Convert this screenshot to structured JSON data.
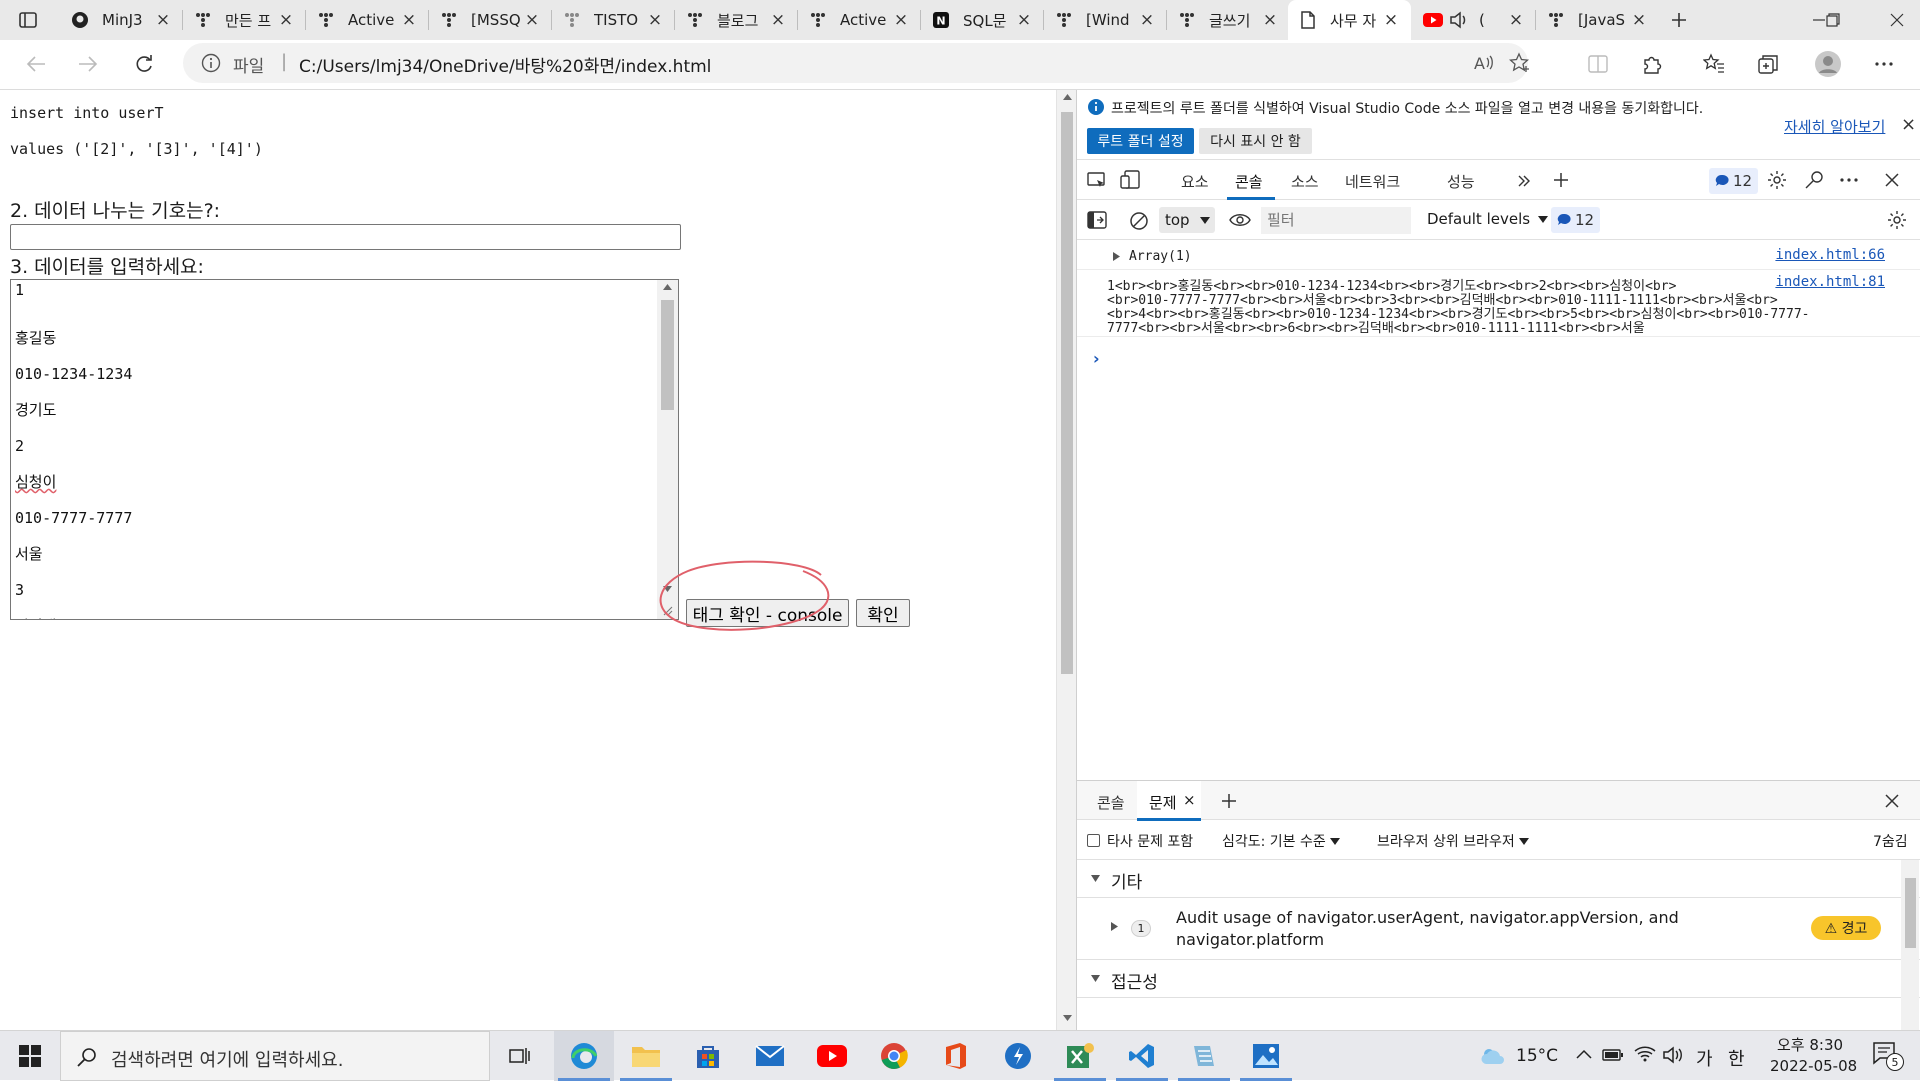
{
  "tabs": [
    {
      "label": "MinJ3",
      "icon": "github"
    },
    {
      "label": "만든 프",
      "icon": "tistory"
    },
    {
      "label": "Active",
      "icon": "tistory"
    },
    {
      "label": "[MSSQ",
      "icon": "tistory"
    },
    {
      "label": "TISTO",
      "icon": "tistory"
    },
    {
      "label": "블로그",
      "icon": "tistory"
    },
    {
      "label": "Active",
      "icon": "tistory"
    },
    {
      "label": "SQL문",
      "icon": "notion"
    },
    {
      "label": "[Wind",
      "icon": "tistory-bracket"
    },
    {
      "label": "글쓰기",
      "icon": "tistory"
    },
    {
      "label": "사무 자",
      "icon": "page",
      "active": true
    },
    {
      "label": "(",
      "icon": "youtube"
    },
    {
      "label": "[JavaS",
      "icon": "tistory"
    }
  ],
  "address": {
    "scheme_label": "파일",
    "separator": "|",
    "url": "C:/Users/lmj34/OneDrive/바탕%20화면/index.html"
  },
  "page": {
    "sql_line1": "insert into userT",
    "sql_line2": "values ('[2]', '[3]', '[4]')",
    "q2_label": "2. 데이터 나누는 기호는?:",
    "q2_value": "",
    "q3_label": "3. 데이터를 입력하세요:",
    "textarea_lines": [
      "1",
      "홍길동",
      "010-1234-1234",
      "경기도",
      "2",
      "심청이",
      "010-7777-7777",
      "서울",
      "3",
      "김덕배"
    ],
    "btn_tag_check": "태그 확인 - console",
    "btn_confirm": "확인"
  },
  "devtools": {
    "info_text": "프로젝트의 루트 폴더를 식별하여 Visual Studio Code 소스 파일을 열고 변경 내용을 동기화합니다.",
    "info_link": "자세히 알아보기",
    "btn_set_root": "루트 폴더 설정",
    "btn_dont_show": "다시 표시 안 함",
    "tabs": [
      "요소",
      "콘솔",
      "소스",
      "네트워크",
      "성능"
    ],
    "active_tab": "콘솔",
    "issue_count": "12",
    "context": "top",
    "filter_placeholder": "필터",
    "levels": "Default levels",
    "levels_count": "12",
    "console": [
      {
        "text": "Array(1)",
        "source": "index.html:66"
      },
      {
        "lines": [
          "1<br><br>홍길동<br><br>010-1234-1234<br><br>경기도<br><br>2<br><br>심청이<br>",
          "<br>010-7777-7777<br><br>서울<br><br>3<br><br>김덕배<br><br>010-1111-1111<br><br>서울<br>",
          "<br>4<br><br>홍길동<br><br>010-1234-1234<br><br>경기도<br><br>5<br><br>심청이<br><br>010-7777-",
          "7777<br><br>서울<br><br>6<br><br>김덕배<br><br>010-1111-1111<br><br>서울"
        ],
        "source": "index.html:81"
      }
    ],
    "prompt": "›",
    "drawer_tabs": [
      "콘솔",
      "문제"
    ],
    "drawer_active": "문제",
    "third_party_label": "타사 문제 포함",
    "severity_label": "심각도: 기본 수준",
    "browser_label": "브라우저 상위 브라우저",
    "hidden_count": "7숨김",
    "group_other": "기타",
    "issue_count_small": "1",
    "issue_text_1": "Audit usage of navigator.userAgent, navigator.appVersion, and",
    "issue_text_2": "navigator.platform",
    "warning_badge": "⚠ 경고",
    "group_accessibility": "접근성"
  },
  "taskbar": {
    "search_placeholder": "검색하려면 여기에 입력하세요.",
    "weather": "15°C",
    "ime": "가",
    "ime2": "한",
    "time": "오후 8:30",
    "date": "2022-05-08",
    "notifications": "5"
  },
  "colors": {
    "accent_blue": "#0f6cbd",
    "tab_strip": "#e9e9e9",
    "annotation_red": "#e0606a",
    "warning_yellow": "#f8c52b"
  }
}
